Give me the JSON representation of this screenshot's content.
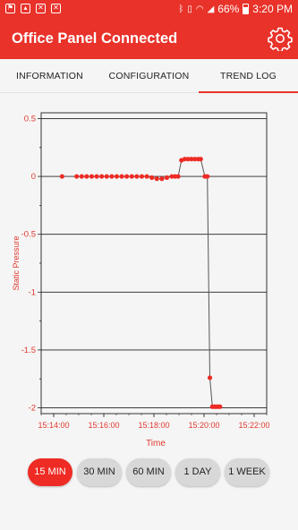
{
  "status_bar": {
    "left_icons": [
      "flag-icon",
      "image-icon",
      "x-app-icon",
      "x-app-icon"
    ],
    "right_icons": [
      "bluetooth-icon",
      "vibrate-icon",
      "wifi-icon",
      "signal-icon"
    ],
    "battery": "66%",
    "time": "3:20 PM"
  },
  "app_bar": {
    "title": "Office Panel Connected",
    "settings_icon": "gear-icon"
  },
  "tabs": [
    {
      "label": "INFORMATION",
      "active": false
    },
    {
      "label": "CONFIGURATION",
      "active": false
    },
    {
      "label": "TREND LOG",
      "active": true
    }
  ],
  "chart_data": {
    "type": "line",
    "xlabel": "Time",
    "ylabel": "Static Pressure",
    "x_ticks": [
      "15:14:00",
      "15:16:00",
      "15:18:00",
      "15:20:00",
      "15:22:00"
    ],
    "y_ticks": [
      "0.5",
      "0",
      "-0.5",
      "-1",
      "-1.5",
      "-2"
    ],
    "ylim": [
      -2.05,
      0.55
    ],
    "xlim": [
      "15:13:30",
      "15:22:30"
    ],
    "grid": true,
    "colors": {
      "line": "#555555",
      "marker": "#ee2b24",
      "axis_label": "#e03a30"
    },
    "series": [
      {
        "x": [
          "15:14:20",
          "15:14:55",
          "15:15:07",
          "15:15:19",
          "15:15:31",
          "15:15:43",
          "15:15:55",
          "15:16:07",
          "15:16:19",
          "15:16:31",
          "15:16:43",
          "15:16:55",
          "15:17:07",
          "15:17:19",
          "15:17:31",
          "15:17:43",
          "15:17:55",
          "15:18:07",
          "15:18:19",
          "15:18:31",
          "15:18:43",
          "15:18:51",
          "15:18:58",
          "15:19:06",
          "15:19:14",
          "15:19:22",
          "15:19:30",
          "15:19:38",
          "15:19:46",
          "15:19:52",
          "15:20:02",
          "15:20:08",
          "15:20:14",
          "15:20:20",
          "15:20:26",
          "15:20:32",
          "15:20:38"
        ],
        "values": [
          0.0,
          0.0,
          0.0,
          0.0,
          0.0,
          0.0,
          0.0,
          0.0,
          0.0,
          0.0,
          0.0,
          0.0,
          0.0,
          0.0,
          0.0,
          0.0,
          -0.01,
          -0.02,
          -0.02,
          -0.01,
          0.0,
          0.0,
          0.0,
          0.14,
          0.15,
          0.15,
          0.15,
          0.15,
          0.15,
          0.15,
          0.0,
          0.0,
          -1.74,
          -1.99,
          -1.99,
          -1.99,
          -1.99
        ]
      }
    ]
  },
  "ranges": [
    {
      "label": "15 MIN",
      "active": true
    },
    {
      "label": "30 MIN",
      "active": false
    },
    {
      "label": "60 MIN",
      "active": false
    },
    {
      "label": "1 DAY",
      "active": false
    },
    {
      "label": "1 WEEK",
      "active": false
    }
  ]
}
